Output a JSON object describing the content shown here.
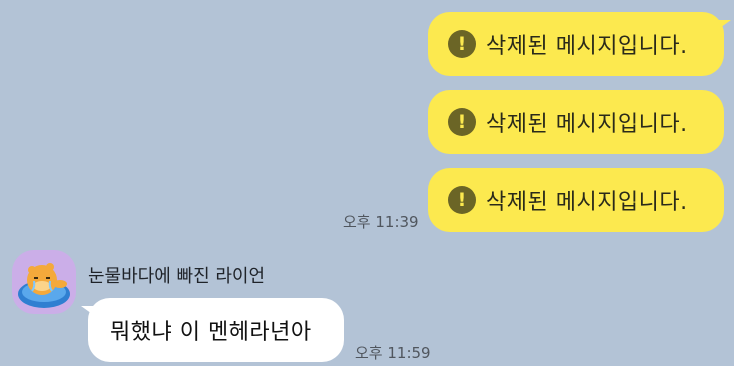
{
  "chat": {
    "sent_messages": [
      {
        "icon": "warning-icon",
        "glyph": "!",
        "text": "삭제된 메시지입니다."
      },
      {
        "icon": "warning-icon",
        "glyph": "!",
        "text": "삭제된 메시지입니다."
      },
      {
        "icon": "warning-icon",
        "glyph": "!",
        "text": "삭제된 메시지입니다."
      }
    ],
    "sent_time": "오후 11:39",
    "received": {
      "sender_name": "눈물바다에 빠진 라이언",
      "avatar_icon": "ryan-avatar-icon",
      "text": "뭐했냐 이 멘헤라년아",
      "time": "오후 11:59"
    }
  },
  "colors": {
    "background": "#b3c3d6",
    "sent_bubble": "#fce94f",
    "received_bubble": "#ffffff"
  }
}
